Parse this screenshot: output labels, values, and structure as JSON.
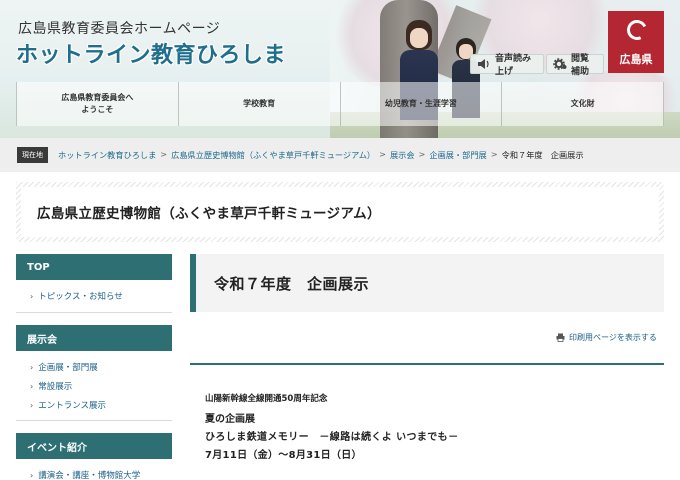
{
  "header": {
    "subtitle": "広島県教育委員会ホームページ",
    "title": "ホットライン教育ひろしま",
    "voice_button": "音声読み上げ",
    "assist_button": "閲覧補助",
    "pref_logo_text": "広島県"
  },
  "gnav": {
    "items": [
      {
        "line1": "広島県教育委員会へ",
        "line2": "ようこそ"
      },
      {
        "line1": "学校教育",
        "line2": ""
      },
      {
        "line1": "幼児教育・生涯学習",
        "line2": ""
      },
      {
        "line1": "文化財",
        "line2": ""
      }
    ]
  },
  "breadcrumb": {
    "label": "現在地",
    "links": [
      "ホットライン教育ひろしま",
      "広島県立歴史博物館（ふくやま草戸千軒ミュージアム）",
      "展示会",
      "企画展・部門展"
    ],
    "separator": ">",
    "current": "令和７年度　企画展示"
  },
  "museum_title": "広島県立歴史博物館（ふくやま草戸千軒ミュージアム）",
  "sidebar": {
    "sections": [
      {
        "heading": "TOP",
        "links": [
          "トピックス・お知らせ"
        ]
      },
      {
        "heading": "展示会",
        "links": [
          "企画展・部門展",
          "常設展示",
          "エントランス展示"
        ]
      },
      {
        "heading": "イベント紹介",
        "links": [
          "講演会・講座・博物館大学"
        ]
      }
    ]
  },
  "main": {
    "page_title": "令和７年度　企画展示",
    "print_link": "印刷用ページを表示する",
    "exhibition": {
      "anniversary": "山陽新幹線全線開通50周年記念",
      "type": "夏の企画展",
      "title": "ひろしま鉄道メモリー　－線路は続くよ いつまでも－",
      "dates": "7月11日（金）～8月31日（日）"
    }
  },
  "colors": {
    "accent": "#2d6f73",
    "link": "#1a5f8a",
    "title_blue": "#1e6e8c",
    "pref_red": "#b42732"
  }
}
